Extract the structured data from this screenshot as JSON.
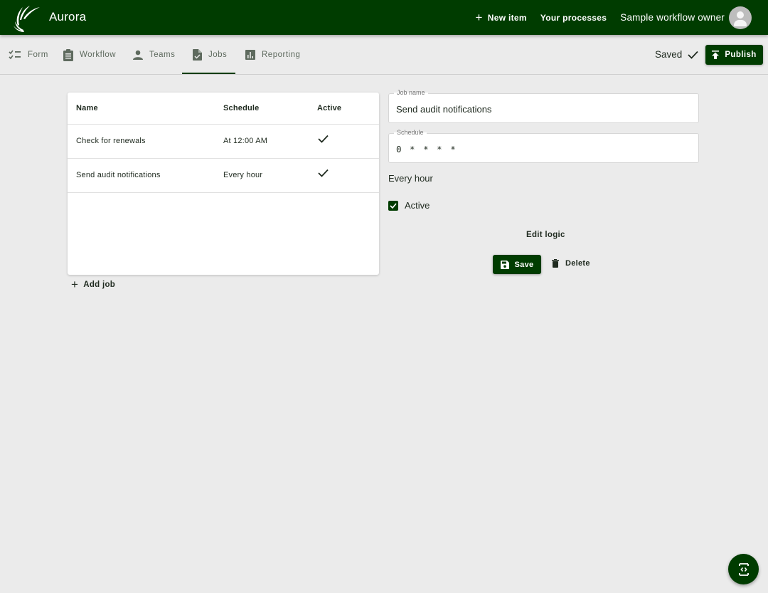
{
  "app": {
    "title": "Aurora",
    "brand_color": "#003c00"
  },
  "topbar": {
    "new_item_label": "New item",
    "your_processes_label": "Your processes",
    "owner_name": "Sample workflow owner"
  },
  "tabs": [
    {
      "label": "Form",
      "icon": "checklist-icon",
      "active": false
    },
    {
      "label": "Workflow",
      "icon": "clipboard-icon",
      "active": false
    },
    {
      "label": "Teams",
      "icon": "person-icon",
      "active": false
    },
    {
      "label": "Jobs",
      "icon": "task-document-icon",
      "active": true
    },
    {
      "label": "Reporting",
      "icon": "bar-chart-icon",
      "active": false
    }
  ],
  "status": {
    "saved_label": "Saved",
    "publish_label": "Publish"
  },
  "jobs_table": {
    "columns": [
      "Name",
      "Schedule",
      "Active"
    ],
    "rows": [
      {
        "name": "Check for renewals",
        "schedule": "At 12:00 AM",
        "active": true
      },
      {
        "name": "Send audit notifications",
        "schedule": "Every hour",
        "active": true
      }
    ],
    "add_job_label": "Add job"
  },
  "job_editor": {
    "job_name_label": "Job name",
    "job_name_value": "Send audit notifications",
    "schedule_label": "Schedule",
    "schedule_value": "0 * * * *",
    "schedule_description": "Every hour",
    "active_label": "Active",
    "active_checked": true,
    "edit_logic_label": "Edit logic",
    "save_label": "Save",
    "delete_label": "Delete"
  },
  "fab": {
    "icon": "code-device-icon"
  }
}
